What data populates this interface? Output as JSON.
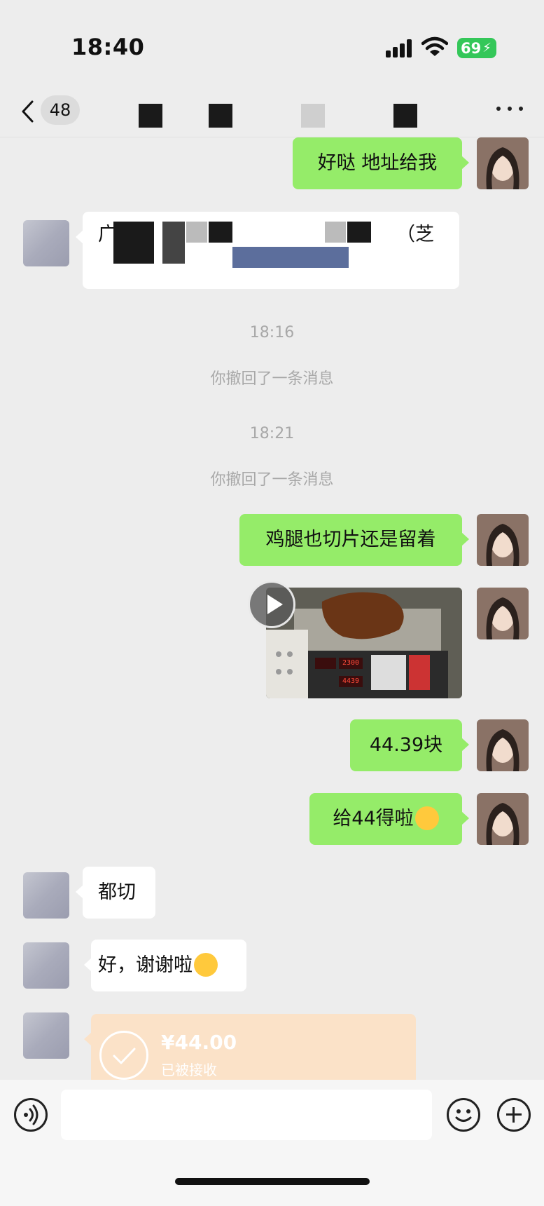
{
  "status_bar": {
    "time": "18:40",
    "battery": "69",
    "icons": [
      "signal-icon",
      "wifi-icon",
      "battery-charging-icon"
    ]
  },
  "nav": {
    "back_count": "48",
    "more_icon": "more-dots-icon"
  },
  "messages": {
    "mine_1": "好哒  地址给我",
    "other_address_start": "广",
    "other_address_end": "（芝",
    "time_1": "18:16",
    "recalled_1": "你撤回了一条消息",
    "time_2": "18:21",
    "recalled_2": "你撤回了一条消息",
    "mine_2": "鸡腿也切片还是留着",
    "scale_weight": "2300",
    "scale_total": "4439",
    "mine_3": "44.39块",
    "mine_4": "给44得啦",
    "other_1": "都切",
    "other_2": "好，谢谢啦"
  },
  "transfer": {
    "amount": "¥44.00",
    "status": "已被接收"
  },
  "input_bar": {
    "icons": [
      "voice-icon",
      "emoji-icon",
      "plus-icon"
    ]
  },
  "colors": {
    "background": "#ededed",
    "bubble_mine": "#95ec69",
    "bubble_other": "#ffffff",
    "transfer": "#fbe2c8",
    "battery": "#34c759"
  }
}
